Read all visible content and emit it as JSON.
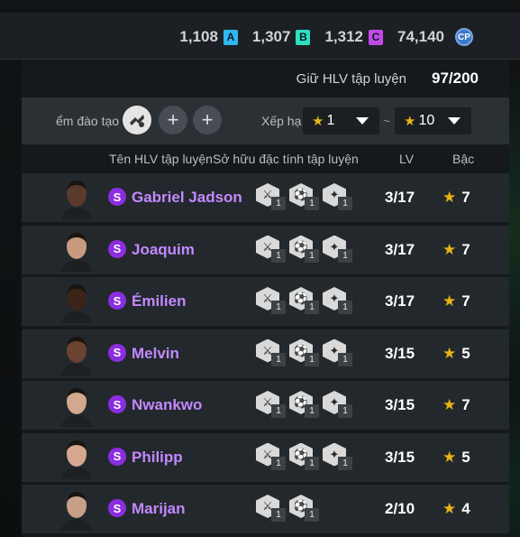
{
  "currencies": [
    {
      "value": "1,108",
      "badge": "A",
      "color": "#2fb8f0"
    },
    {
      "value": "1,307",
      "badge": "B",
      "color": "#2ee0c0"
    },
    {
      "value": "1,312",
      "badge": "C",
      "color": "#c04ae8"
    },
    {
      "value": "74,140",
      "badge": "CP",
      "color": "#3e78c8"
    }
  ],
  "keep": {
    "label": "Giữ HLV tập luyện",
    "count": "97/200"
  },
  "filter": {
    "skill_label": "ểm đào tạo",
    "add_symbol": "+",
    "rank_label": "Xếp hạ",
    "rank_from": "1",
    "rank_to": "10",
    "tilde": "~"
  },
  "headers": {
    "name": "Tên HLV tập luyện",
    "traits": "Sở hữu đặc tính tập luyện",
    "lv": "LV",
    "grade": "Bậc"
  },
  "coaches": [
    {
      "badge": "S",
      "name": "Gabriel Jadson",
      "traits": [
        "1",
        "1",
        "1"
      ],
      "lv": "3/17",
      "grade": "7",
      "skin": "#5a3a2a"
    },
    {
      "badge": "S",
      "name": "Joaquim",
      "traits": [
        "1",
        "1",
        "1"
      ],
      "lv": "3/17",
      "grade": "7",
      "skin": "#c89a80"
    },
    {
      "badge": "S",
      "name": "Émilien",
      "traits": [
        "1",
        "1",
        "1"
      ],
      "lv": "3/17",
      "grade": "7",
      "skin": "#3a2418"
    },
    {
      "badge": "S",
      "name": "Melvin",
      "traits": [
        "1",
        "1",
        "1"
      ],
      "lv": "3/15",
      "grade": "5",
      "skin": "#6a4430"
    },
    {
      "badge": "S",
      "name": "Nwankwo",
      "traits": [
        "1",
        "1",
        "1"
      ],
      "lv": "3/15",
      "grade": "7",
      "skin": "#d2a88e"
    },
    {
      "badge": "S",
      "name": "Philipp",
      "traits": [
        "1",
        "1",
        "1"
      ],
      "lv": "3/15",
      "grade": "5",
      "skin": "#d6a890"
    },
    {
      "badge": "S",
      "name": "Marijan",
      "traits": [
        "1",
        "1"
      ],
      "lv": "2/10",
      "grade": "4",
      "skin": "#c8a088"
    }
  ]
}
